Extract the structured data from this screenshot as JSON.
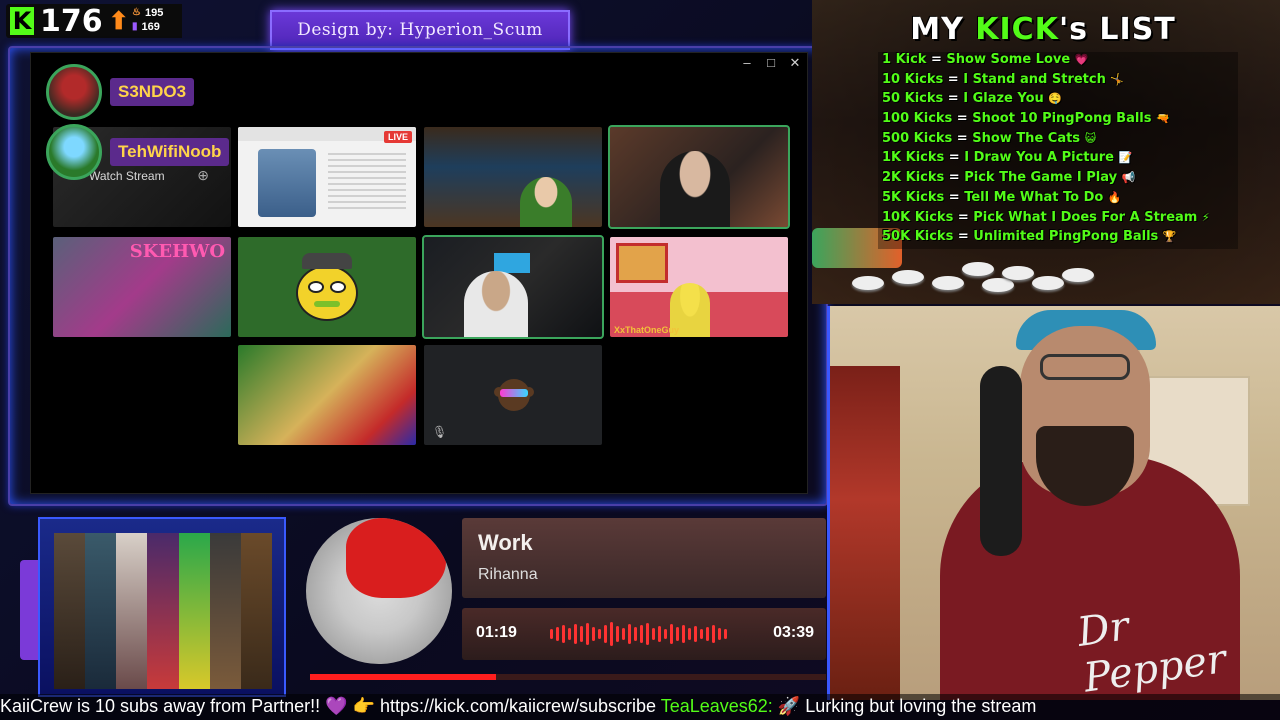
{
  "stream": {
    "kick_count": "176",
    "stat_1": "195",
    "stat_2": "169",
    "design_credit": "Design by: Hyperion_Scum"
  },
  "discord": {
    "window_controls": [
      "–",
      "□",
      "✕"
    ],
    "speakers": [
      {
        "name": "S3NDO3"
      },
      {
        "name": "TehWifiNoob"
      }
    ],
    "watch_stream_label": "Watch Stream",
    "live_label": "LIVE",
    "tile_e_title": "SKEHWO",
    "tile_h_name": "XxThatOneGuy"
  },
  "kick_list": {
    "title_a": "MY ",
    "title_b": "KICK",
    "title_c": "'s LIST",
    "items": [
      {
        "amount": "1 Kick",
        "reward": "Show Some Love",
        "emoji": "💗"
      },
      {
        "amount": "10 Kicks",
        "reward": "I Stand and Stretch",
        "emoji": "🤸"
      },
      {
        "amount": "50 Kicks",
        "reward": "I Glaze You",
        "emoji": "🤤"
      },
      {
        "amount": "100 Kicks",
        "reward": "Shoot 10 PingPong Balls",
        "emoji": "🔫"
      },
      {
        "amount": "500 Kicks",
        "reward": "Show The Cats",
        "emoji": "😺"
      },
      {
        "amount": "1K Kicks",
        "reward": "I Draw You A Picture",
        "emoji": "📝"
      },
      {
        "amount": "2K Kicks",
        "reward": "Pick The Game I Play",
        "emoji": "📢"
      },
      {
        "amount": "5K Kicks",
        "reward": "Tell Me What To Do",
        "emoji": "🔥"
      },
      {
        "amount": "10K Kicks",
        "reward": "Pick What I Does For A Stream",
        "emoji": "⚡"
      },
      {
        "amount": "50K Kicks",
        "reward": "Unlimited PingPong Balls",
        "emoji": "🏆"
      }
    ]
  },
  "webcam": {
    "shirt_logo": "Dr Pepper"
  },
  "music": {
    "title": "Work",
    "artist": "Rihanna",
    "current_time": "01:19",
    "total_time": "03:39",
    "progress": 0.36
  },
  "ticker": {
    "text_1": "KaiiCrew is 10 subs away from Partner!! 💜 👉 https://kick.com/kaiicrew/subscribe ",
    "user": "TeaLeaves62:",
    "text_2": " 🚀 Lurking but loving the stream"
  },
  "colors": {
    "kick_green": "#53fc18",
    "speaking_green": "#3ba55c",
    "accent_purple": "#6a38d8"
  }
}
